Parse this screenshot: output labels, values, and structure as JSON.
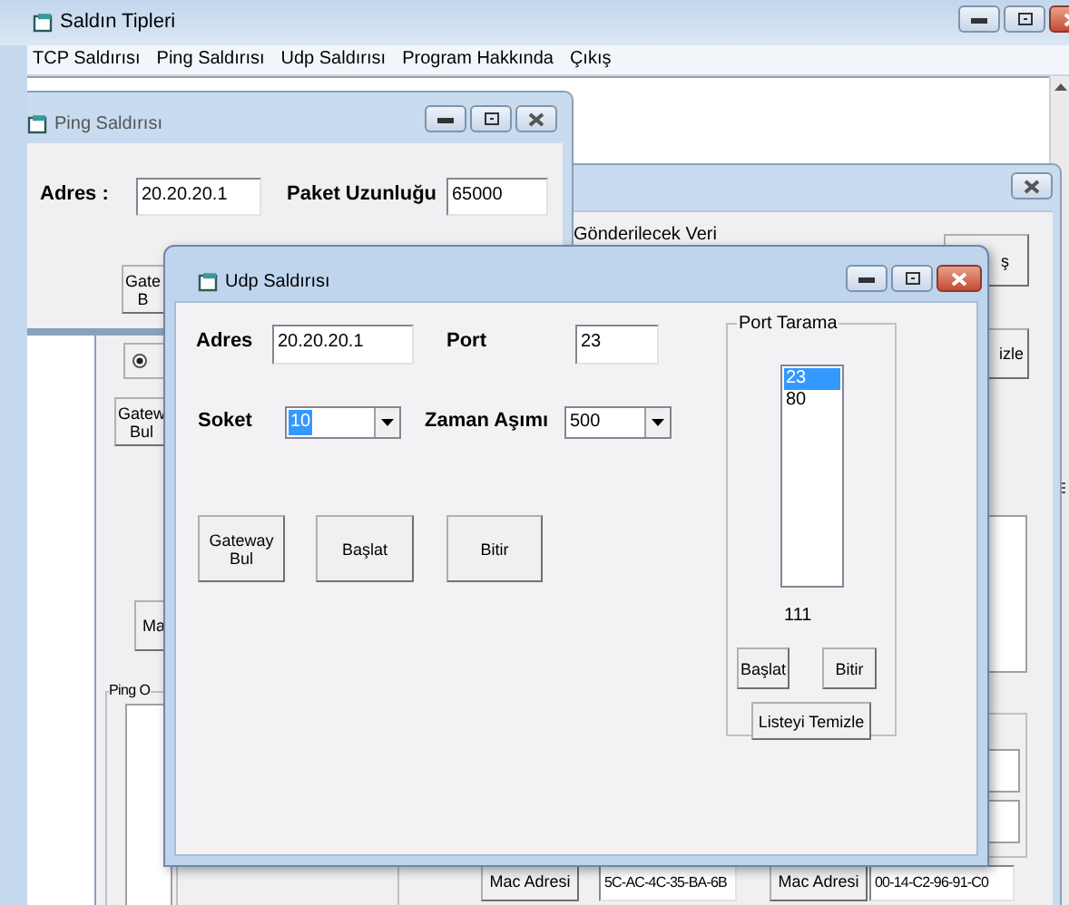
{
  "main_window": {
    "title": "Saldın Tipleri",
    "menu": [
      {
        "label": "TCP Saldırısı"
      },
      {
        "label": "Ping Saldırısı"
      },
      {
        "label": "Udp Saldırısı"
      },
      {
        "label": "Program Hakkında"
      },
      {
        "label": "Çıkış"
      }
    ]
  },
  "tcp_window": {
    "data_label": "Gönderilecek Veri",
    "button_right_top": "ş",
    "button_right_mid": "izle",
    "radio": {
      "selected": true
    },
    "gateway_button": "Gatew\nBul",
    "mac_button": "Ma",
    "ping_group": "Ping O",
    "mac_rows": [
      {
        "label": "Mac Adresi",
        "value": "5C-AC-4C-35-BA-6B"
      },
      {
        "label": "Mac Adresi",
        "value": "00-14-C2-96-91-C0"
      }
    ]
  },
  "ping_window": {
    "title": "Ping Saldırısı",
    "address_label": "Adres :",
    "address": "20.20.20.1",
    "packet_label": "Paket Uzunluğu",
    "packet": "65000",
    "gateway_button": "Gate\nB"
  },
  "udp_window": {
    "title": "Udp Saldırısı",
    "address_label": "Adres",
    "address": "20.20.20.1",
    "port_label": "Port",
    "port": "23",
    "socket_label": "Soket",
    "socket": {
      "value": "10",
      "focused": true
    },
    "timeout_label": "Zaman Aşımı",
    "timeout": {
      "value": "500",
      "focused": false
    },
    "buttons": [
      "Gateway\nBul",
      "Başlat",
      "Bitir"
    ],
    "port_scan": {
      "title": "Port Tarama",
      "ports": [
        {
          "text": "23",
          "selected": true
        },
        {
          "text": "80",
          "selected": false
        }
      ],
      "count": "111",
      "start": "Başlat",
      "stop": "Bitir",
      "clear": "Listeyi Temizle"
    }
  }
}
